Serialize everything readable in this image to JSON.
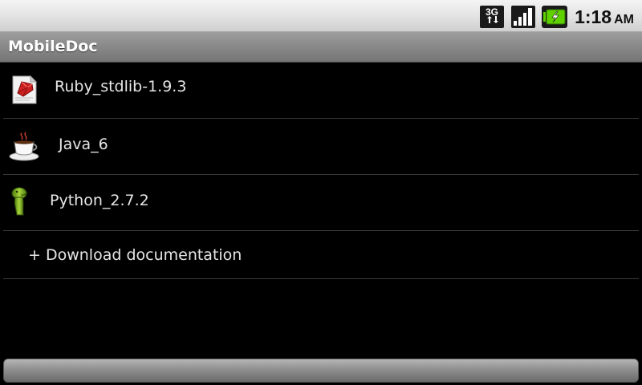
{
  "status_bar": {
    "network_type": "3G",
    "time": "1:18",
    "ampm": "AM",
    "icons": [
      "3g-data-icon",
      "signal-strength-icon",
      "battery-charging-icon"
    ]
  },
  "app": {
    "title": "MobileDoc"
  },
  "documents": [
    {
      "label": "Ruby_stdlib-1.9.3",
      "icon": "ruby-icon"
    },
    {
      "label": "Java_6",
      "icon": "java-coffee-cup-icon"
    },
    {
      "label": "Python_2.7.2",
      "icon": "python-icon"
    }
  ],
  "download_action": {
    "label": "+ Download documentation"
  },
  "colors": {
    "background": "#000000",
    "list_text": "#e6e6e6",
    "title_bar": "#8a8a8a",
    "battery_accent": "#5fd000",
    "python_green": "#7fb51f",
    "ruby_red": "#cc1f1f"
  }
}
